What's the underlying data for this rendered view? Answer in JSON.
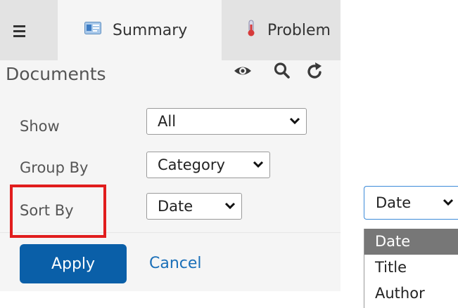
{
  "tabs": {
    "summary": "Summary",
    "problems": "Problem"
  },
  "toolbar": {
    "title": "Documents",
    "icons": [
      "eye-icon",
      "search-icon",
      "refresh-icon"
    ]
  },
  "form": {
    "show": {
      "label": "Show",
      "value": "All"
    },
    "group_by": {
      "label": "Group By",
      "value": "Category"
    },
    "sort_by": {
      "label": "Sort By",
      "value": "Date"
    }
  },
  "footer": {
    "apply": "Apply",
    "cancel": "Cancel"
  },
  "dropdown": {
    "value": "Date",
    "options": [
      "Date",
      "Title",
      "Author"
    ],
    "selected_index": 0
  },
  "colors": {
    "accent": "#0a5fa8",
    "link": "#1a6fb8",
    "highlight": "#e11d1d",
    "selected_option": "#777777"
  }
}
